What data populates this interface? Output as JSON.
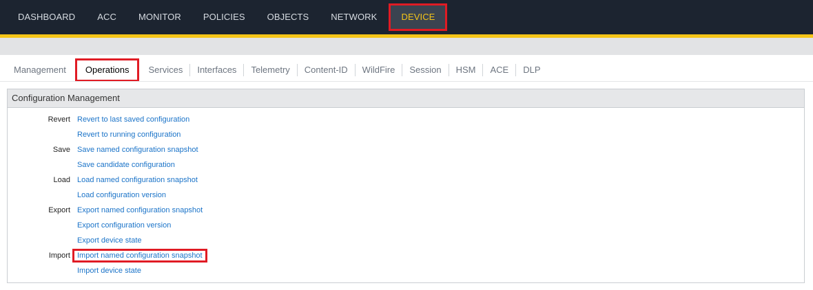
{
  "top_nav": {
    "items": [
      {
        "label": "DASHBOARD",
        "active": false
      },
      {
        "label": "ACC",
        "active": false
      },
      {
        "label": "MONITOR",
        "active": false
      },
      {
        "label": "POLICIES",
        "active": false
      },
      {
        "label": "OBJECTS",
        "active": false
      },
      {
        "label": "NETWORK",
        "active": false
      },
      {
        "label": "DEVICE",
        "active": true
      }
    ]
  },
  "sub_tabs": {
    "items": [
      {
        "label": "Management",
        "active": false
      },
      {
        "label": "Operations",
        "active": true
      },
      {
        "label": "Services",
        "active": false
      },
      {
        "label": "Interfaces",
        "active": false
      },
      {
        "label": "Telemetry",
        "active": false
      },
      {
        "label": "Content-ID",
        "active": false
      },
      {
        "label": "WildFire",
        "active": false
      },
      {
        "label": "Session",
        "active": false
      },
      {
        "label": "HSM",
        "active": false
      },
      {
        "label": "ACE",
        "active": false
      },
      {
        "label": "DLP",
        "active": false
      }
    ]
  },
  "panel": {
    "title": "Configuration Management",
    "rows": [
      {
        "label": "Revert",
        "link": "Revert to last saved configuration"
      },
      {
        "label": "",
        "link": "Revert to running configuration"
      },
      {
        "label": "Save",
        "link": "Save named configuration snapshot"
      },
      {
        "label": "",
        "link": "Save candidate configuration"
      },
      {
        "label": "Load",
        "link": "Load named configuration snapshot"
      },
      {
        "label": "",
        "link": "Load configuration version"
      },
      {
        "label": "Export",
        "link": "Export named configuration snapshot"
      },
      {
        "label": "",
        "link": "Export configuration version"
      },
      {
        "label": "",
        "link": "Export device state"
      },
      {
        "label": "Import",
        "link": "Import named configuration snapshot",
        "highlighted": true
      },
      {
        "label": "",
        "link": "Import device state"
      }
    ]
  },
  "colors": {
    "topbar": "#1c2430",
    "accent": "#f5c518",
    "link": "#1a73c8",
    "highlight": "#e01b24"
  }
}
